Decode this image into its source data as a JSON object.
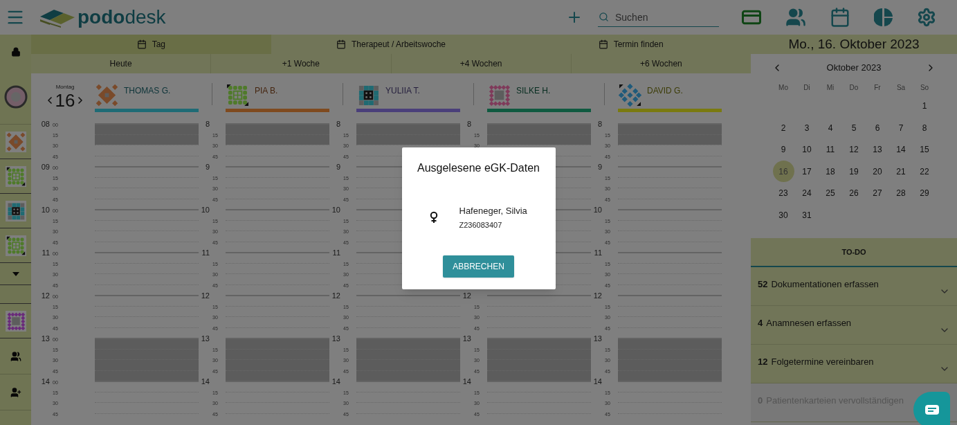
{
  "header": {
    "logo": "**podo**desk",
    "search": {
      "placeholder": "Suchen"
    }
  },
  "view_tabs": [
    {
      "label": "Tag",
      "selected": true
    },
    {
      "label": "Therapeut / Arbeitswoche",
      "selected": false
    },
    {
      "label": "Termin finden",
      "selected": false
    }
  ],
  "jump_buttons": [
    "Heute",
    "+1 Woche",
    "+4 Wochen",
    "+6 Wochen"
  ],
  "day": {
    "weekday": "Montag",
    "date": "16"
  },
  "time_axis": [
    {
      "hour": "08",
      "minutes": [
        "00",
        "15",
        "30",
        "45"
      ]
    },
    {
      "hour": "09",
      "minutes": [
        "00",
        "15",
        "30",
        "45"
      ]
    },
    {
      "hour": "10",
      "minutes": [
        "00",
        "15",
        "30",
        "45"
      ]
    },
    {
      "hour": "11",
      "minutes": [
        "00",
        "15",
        "30",
        "45"
      ]
    },
    {
      "hour": "12",
      "minutes": [
        "00",
        "15",
        "30",
        "45"
      ]
    },
    {
      "hour": "13",
      "minutes": [
        "00",
        "15",
        "30",
        "45"
      ]
    },
    {
      "hour": "14",
      "minutes": [
        "00",
        "15",
        "30",
        "45"
      ]
    }
  ],
  "therapists": [
    {
      "name": "THOMAS G.",
      "color": "#1f6b75",
      "avatar": {
        "kind": "diamond",
        "color": "#7a4a2a"
      },
      "rows": [
        {
          "blocked": [
            true,
            true,
            false,
            false
          ]
        },
        {
          "blocked": [
            false,
            false,
            false,
            false
          ]
        },
        {
          "blocked": [
            false,
            false,
            false,
            false
          ]
        },
        {
          "blocked": [
            false,
            false,
            false,
            false
          ]
        },
        {
          "blocked": [
            false,
            false,
            false,
            false
          ]
        },
        {
          "blocked": [
            true,
            true,
            true,
            true
          ]
        },
        {
          "blocked": [
            false,
            false,
            false,
            false
          ]
        }
      ]
    },
    {
      "name": "PIA B.",
      "color": "#8a4a1f",
      "avatar": {
        "kind": "grid",
        "color": "#4f7a2a"
      },
      "rows": [
        {
          "hour": "8",
          "minutes": [
            "15",
            "30",
            "45"
          ],
          "blocked": [
            true,
            true,
            false,
            false
          ]
        },
        {
          "hour": "9",
          "minutes": [
            "15",
            "30",
            "45"
          ],
          "blocked": [
            false,
            false,
            false,
            false
          ]
        },
        {
          "hour": "10",
          "minutes": [
            "15",
            "30",
            "45"
          ],
          "blocked": [
            false,
            false,
            false,
            false
          ]
        },
        {
          "hour": "11",
          "minutes": [
            "15",
            "30",
            "45"
          ],
          "blocked": [
            false,
            false,
            false,
            false
          ]
        },
        {
          "hour": "12",
          "minutes": [
            "15",
            "30",
            "45"
          ],
          "blocked": [
            false,
            false,
            false,
            false
          ]
        },
        {
          "hour": "13",
          "minutes": [
            "15",
            "30",
            "45"
          ],
          "blocked": [
            true,
            true,
            true,
            true
          ]
        },
        {
          "hour": "14",
          "minutes": [
            "15",
            "30",
            "45"
          ],
          "blocked": [
            false,
            false,
            false,
            false
          ]
        }
      ]
    },
    {
      "name": "YULIIA T.",
      "color": "#4a3f7a",
      "avatar": {
        "kind": "dark",
        "color": "#1f6a72"
      },
      "rows": [
        {
          "hour": "8",
          "minutes": [
            "15",
            "30",
            "45"
          ],
          "blocked": [
            true,
            true,
            false,
            false
          ]
        },
        {
          "hour": "9",
          "minutes": [
            "15",
            "30",
            "45"
          ],
          "blocked": [
            false,
            false,
            false,
            false
          ]
        },
        {
          "hour": "10",
          "minutes": [
            "15",
            "30",
            "45"
          ],
          "blocked": [
            false,
            false,
            false,
            false
          ]
        },
        {
          "hour": "11",
          "minutes": [
            "15",
            "30",
            "45"
          ],
          "blocked": [
            false,
            false,
            false,
            false
          ]
        },
        {
          "hour": "12",
          "minutes": [
            "15",
            "30",
            "45"
          ],
          "blocked": [
            false,
            false,
            false,
            false
          ]
        },
        {
          "hour": "13",
          "minutes": [
            "15",
            "30",
            "45"
          ],
          "blocked": [
            true,
            true,
            true,
            true
          ]
        },
        {
          "hour": "14",
          "minutes": [
            "15",
            "30",
            "45"
          ],
          "blocked": [
            false,
            false,
            false,
            false
          ]
        }
      ]
    },
    {
      "name": "SILKE H.",
      "color": "#0f5a40",
      "avatar": {
        "kind": "ring",
        "color": "#8a3a5a"
      },
      "rows": [
        {
          "hour": "8",
          "minutes": [
            "15",
            "30"
          ],
          "blocked": [
            true,
            true,
            false,
            false
          ]
        },
        {
          "blocked": [
            false,
            false,
            false,
            false
          ]
        },
        {
          "blocked": [
            false,
            false,
            false,
            false
          ]
        },
        {
          "blocked": [
            false,
            false,
            false,
            false
          ]
        },
        {
          "hour": "12",
          "minutes": [
            "15",
            "30",
            "45"
          ],
          "blocked": [
            false,
            false,
            false,
            false
          ]
        },
        {
          "hour": "13",
          "minutes": [
            "15",
            "30",
            "45"
          ],
          "blocked": [
            true,
            true,
            true,
            true
          ]
        },
        {
          "hour": "14",
          "minutes": [
            "15",
            "30",
            "45"
          ],
          "blocked": [
            false,
            false,
            false,
            false
          ]
        }
      ]
    },
    {
      "name": "DAVID G.",
      "color": "#7a7a10",
      "avatar": {
        "kind": "cross",
        "color": "#1f5a7a"
      },
      "rows": [
        {
          "hour": "8",
          "minutes": [
            "15",
            "30",
            "45"
          ],
          "blocked": [
            true,
            true,
            false,
            false
          ]
        },
        {
          "hour": "9",
          "minutes": [
            "15",
            "30",
            "45"
          ],
          "blocked": [
            false,
            false,
            false,
            false
          ]
        },
        {
          "hour": "10",
          "minutes": [
            "15",
            "30",
            "45"
          ],
          "blocked": [
            false,
            false,
            false,
            false
          ]
        },
        {
          "hour": "11",
          "minutes": [
            "15",
            "30",
            "45"
          ],
          "blocked": [
            false,
            false,
            false,
            false
          ]
        },
        {
          "hour": "12",
          "minutes": [
            "15",
            "30",
            "45"
          ],
          "blocked": [
            false,
            false,
            false,
            false
          ]
        },
        {
          "hour": "13",
          "minutes": [
            "15",
            "30",
            "45"
          ],
          "blocked": [
            true,
            true,
            true,
            true
          ]
        },
        {
          "hour": "14",
          "minutes": [
            "15",
            "30",
            "45"
          ],
          "blocked": [
            false,
            false,
            false,
            false
          ]
        }
      ]
    }
  ],
  "sidebar": {
    "items": [
      {
        "kind": "lock"
      },
      {
        "kind": "avatar"
      },
      {
        "kind": "diamond",
        "color": "#7a4a2a"
      },
      {
        "kind": "grid",
        "color": "#4f7a2a"
      },
      {
        "kind": "dark",
        "color": "#1f6a72"
      },
      {
        "kind": "grid",
        "color": "#4f7a2a"
      },
      {
        "kind": "caret"
      },
      {
        "kind": "empty"
      },
      {
        "kind": "ring",
        "color": "#6a2a7a"
      },
      {
        "kind": "group"
      },
      {
        "kind": "add_person"
      }
    ]
  },
  "right_panel": {
    "date_title": "Mo., 16. Oktober 2023",
    "calendar": {
      "month": "Oktober 2023",
      "weekdays": [
        "Mo",
        "Di",
        "Mi",
        "Do",
        "Fr",
        "Sa",
        "So"
      ],
      "weeks": [
        {
          "kind": "leading",
          "days": [
            {
              "label": "1",
              "selected": false
            }
          ]
        },
        {
          "days": [
            {
              "label": "2",
              "selected": false
            },
            {
              "label": "3",
              "selected": false
            },
            {
              "label": "4",
              "selected": false
            },
            {
              "label": "5",
              "selected": false
            },
            {
              "label": "6",
              "selected": false
            },
            {
              "label": "7",
              "selected": false
            },
            {
              "label": "8",
              "selected": false
            }
          ]
        },
        {
          "days": [
            {
              "label": "9",
              "selected": false
            },
            {
              "label": "10",
              "selected": false
            },
            {
              "label": "11",
              "selected": false
            },
            {
              "label": "12",
              "selected": false
            },
            {
              "label": "13",
              "selected": false
            },
            {
              "label": "14",
              "selected": false
            },
            {
              "label": "15",
              "selected": false
            }
          ]
        },
        {
          "days": [
            {
              "label": "16",
              "selected": true
            },
            {
              "label": "17",
              "selected": false
            },
            {
              "label": "18",
              "selected": false
            },
            {
              "label": "19",
              "selected": false
            },
            {
              "label": "20",
              "selected": false
            },
            {
              "label": "21",
              "selected": false
            },
            {
              "label": "22",
              "selected": false
            }
          ]
        },
        {
          "days": [
            {
              "label": "23",
              "selected": false
            },
            {
              "label": "24",
              "selected": false
            },
            {
              "label": "25",
              "selected": false
            },
            {
              "label": "26",
              "selected": false
            },
            {
              "label": "27",
              "selected": false
            },
            {
              "label": "28",
              "selected": false
            },
            {
              "label": "29",
              "selected": false
            }
          ]
        },
        {
          "days": [
            {
              "label": "30",
              "selected": false
            },
            {
              "label": "31",
              "selected": false
            }
          ]
        }
      ]
    },
    "todo": {
      "title": "TO-DO",
      "items": [
        {
          "count": "52",
          "label": "Dokumentationen erfassen",
          "disabled": false
        },
        {
          "count": "4",
          "label": "Anamnesen erfassen",
          "disabled": false
        },
        {
          "count": "12",
          "label": "Folgetermine vereinbaren",
          "disabled": false
        },
        {
          "count": "0",
          "label": "Patientenkarteien vervollständigen",
          "disabled": true
        }
      ]
    }
  },
  "dialog": {
    "title": "Ausgelesene eGK-Daten",
    "patient": {
      "kind": "female",
      "name": "Hafeneger, Silvia",
      "number": "Z236083407"
    },
    "button": "ABBRECHEN"
  }
}
